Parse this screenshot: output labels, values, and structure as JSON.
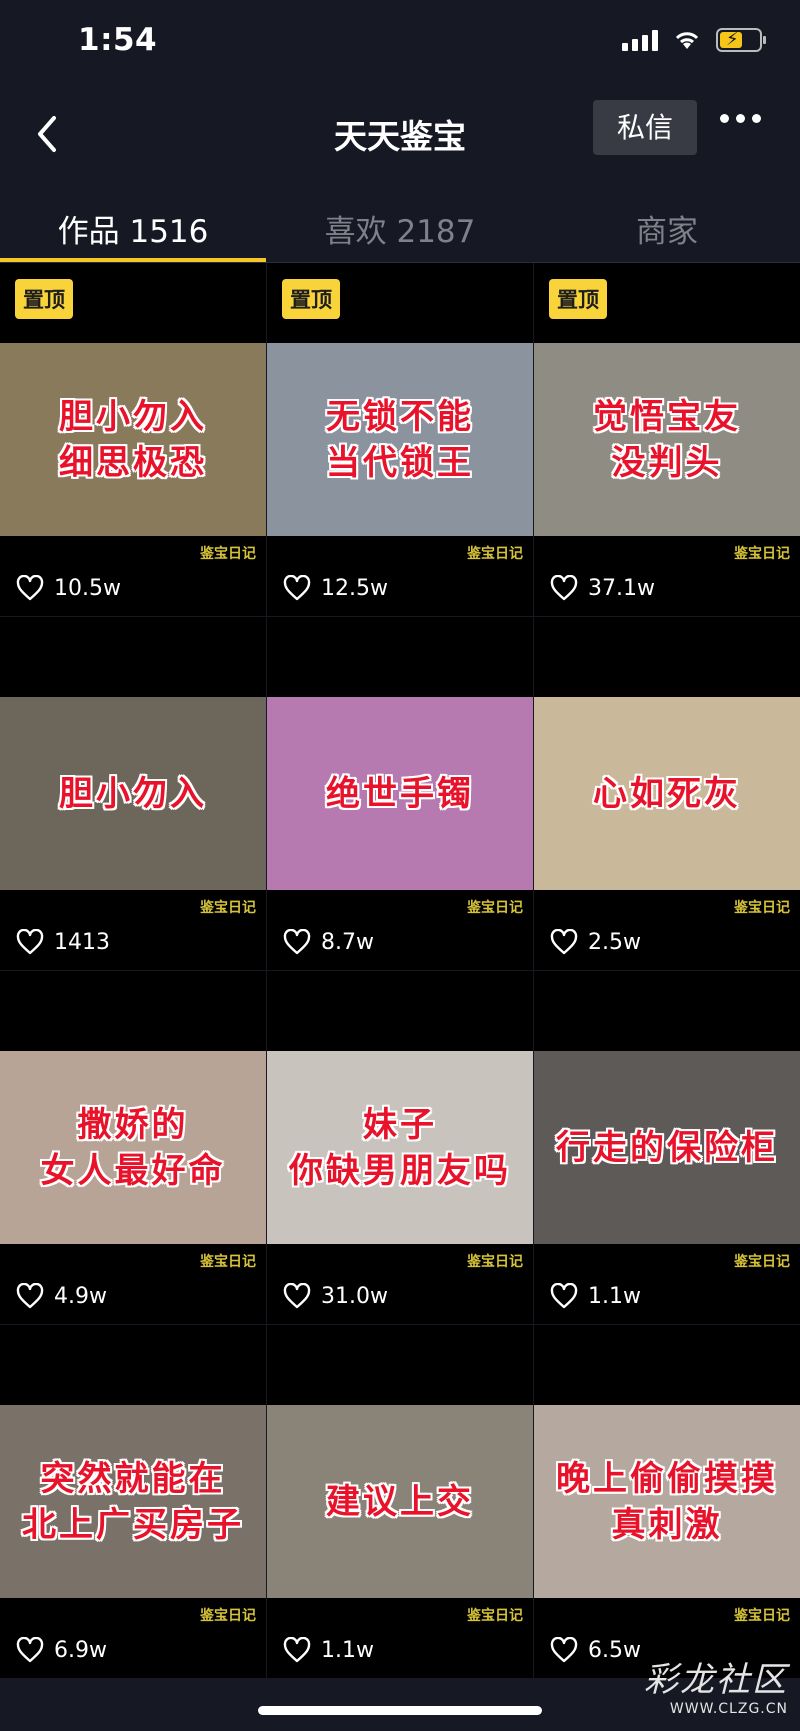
{
  "status": {
    "time": "1:54"
  },
  "header": {
    "title": "天天鉴宝",
    "message_label": "私信"
  },
  "tabs": [
    {
      "label": "作品 1516"
    },
    {
      "label": "喜欢 2187"
    },
    {
      "label": "商家"
    }
  ],
  "videos": [
    {
      "pinned": "置顶",
      "caption": "胆小勿入\n细思极恐",
      "watermark": "鉴宝日记",
      "likes": "10.5w",
      "bg": "#8a7a5c"
    },
    {
      "pinned": "置顶",
      "caption": "无锁不能\n当代锁王",
      "watermark": "鉴宝日记",
      "likes": "12.5w",
      "bg": "#8b939e"
    },
    {
      "pinned": "置顶",
      "caption": "觉悟宝友\n没判头",
      "watermark": "鉴宝日记",
      "likes": "37.1w",
      "bg": "#8f8c84"
    },
    {
      "pinned": "",
      "caption": "胆小勿入",
      "watermark": "鉴宝日记",
      "likes": "1413",
      "bg": "#6d665a"
    },
    {
      "pinned": "",
      "caption": "绝世手镯",
      "watermark": "鉴宝日记",
      "likes": "8.7w",
      "bg": "#b67ab0"
    },
    {
      "pinned": "",
      "caption": "心如死灰",
      "watermark": "鉴宝日记",
      "likes": "2.5w",
      "bg": "#c9b89a"
    },
    {
      "pinned": "",
      "caption": "撒娇的\n女人最好命",
      "watermark": "鉴宝日记",
      "likes": "4.9w",
      "bg": "#b8a496"
    },
    {
      "pinned": "",
      "caption": "妹子\n你缺男朋友吗",
      "watermark": "鉴宝日记",
      "likes": "31.0w",
      "bg": "#c8c3bc"
    },
    {
      "pinned": "",
      "caption": "行走的保险柜",
      "watermark": "鉴宝日记",
      "likes": "1.1w",
      "bg": "#5d5a58"
    },
    {
      "pinned": "",
      "caption": "突然就能在\n北上广买房子",
      "watermark": "鉴宝日记",
      "likes": "6.9w",
      "bg": "#7a7268"
    },
    {
      "pinned": "",
      "caption": "建议上交",
      "watermark": "鉴宝日记",
      "likes": "1.1w",
      "bg": "#8a8478"
    },
    {
      "pinned": "",
      "caption": "晚上偷偷摸摸\n真刺激",
      "watermark": "鉴宝日记",
      "likes": "6.5w",
      "bg": "#b5a99f"
    }
  ],
  "site_watermark": {
    "main": "彩龙社区",
    "sub": "WWW.CLZG.CN"
  },
  "colors": {
    "accent": "#f8c529",
    "caption_red": "#e8132a",
    "background": "#161823"
  }
}
